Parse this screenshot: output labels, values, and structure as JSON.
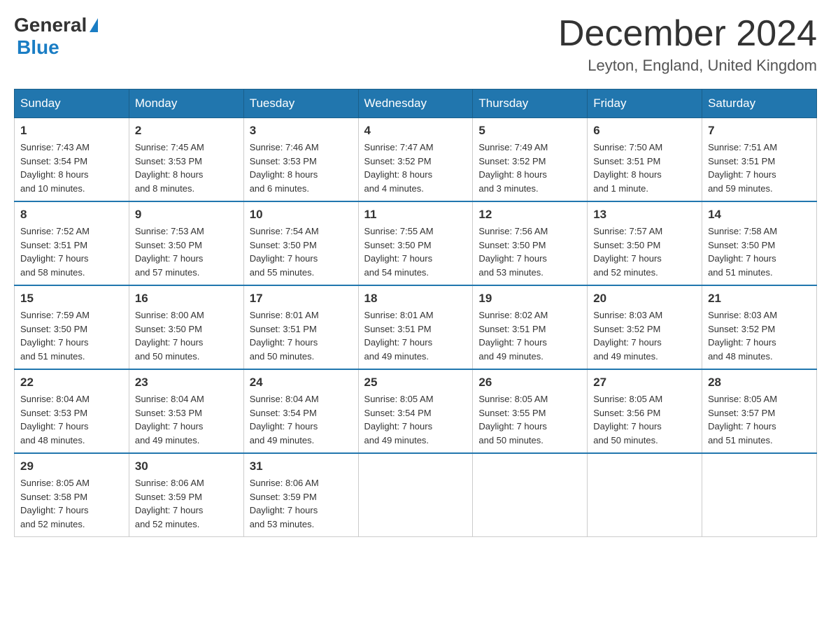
{
  "header": {
    "logo_general": "General",
    "logo_blue": "Blue",
    "title": "December 2024",
    "location": "Leyton, England, United Kingdom"
  },
  "days_of_week": [
    "Sunday",
    "Monday",
    "Tuesday",
    "Wednesday",
    "Thursday",
    "Friday",
    "Saturday"
  ],
  "weeks": [
    [
      {
        "day": "1",
        "sunrise": "7:43 AM",
        "sunset": "3:54 PM",
        "daylight": "8 hours and 10 minutes."
      },
      {
        "day": "2",
        "sunrise": "7:45 AM",
        "sunset": "3:53 PM",
        "daylight": "8 hours and 8 minutes."
      },
      {
        "day": "3",
        "sunrise": "7:46 AM",
        "sunset": "3:53 PM",
        "daylight": "8 hours and 6 minutes."
      },
      {
        "day": "4",
        "sunrise": "7:47 AM",
        "sunset": "3:52 PM",
        "daylight": "8 hours and 4 minutes."
      },
      {
        "day": "5",
        "sunrise": "7:49 AM",
        "sunset": "3:52 PM",
        "daylight": "8 hours and 3 minutes."
      },
      {
        "day": "6",
        "sunrise": "7:50 AM",
        "sunset": "3:51 PM",
        "daylight": "8 hours and 1 minute."
      },
      {
        "day": "7",
        "sunrise": "7:51 AM",
        "sunset": "3:51 PM",
        "daylight": "7 hours and 59 minutes."
      }
    ],
    [
      {
        "day": "8",
        "sunrise": "7:52 AM",
        "sunset": "3:51 PM",
        "daylight": "7 hours and 58 minutes."
      },
      {
        "day": "9",
        "sunrise": "7:53 AM",
        "sunset": "3:50 PM",
        "daylight": "7 hours and 57 minutes."
      },
      {
        "day": "10",
        "sunrise": "7:54 AM",
        "sunset": "3:50 PM",
        "daylight": "7 hours and 55 minutes."
      },
      {
        "day": "11",
        "sunrise": "7:55 AM",
        "sunset": "3:50 PM",
        "daylight": "7 hours and 54 minutes."
      },
      {
        "day": "12",
        "sunrise": "7:56 AM",
        "sunset": "3:50 PM",
        "daylight": "7 hours and 53 minutes."
      },
      {
        "day": "13",
        "sunrise": "7:57 AM",
        "sunset": "3:50 PM",
        "daylight": "7 hours and 52 minutes."
      },
      {
        "day": "14",
        "sunrise": "7:58 AM",
        "sunset": "3:50 PM",
        "daylight": "7 hours and 51 minutes."
      }
    ],
    [
      {
        "day": "15",
        "sunrise": "7:59 AM",
        "sunset": "3:50 PM",
        "daylight": "7 hours and 51 minutes."
      },
      {
        "day": "16",
        "sunrise": "8:00 AM",
        "sunset": "3:50 PM",
        "daylight": "7 hours and 50 minutes."
      },
      {
        "day": "17",
        "sunrise": "8:01 AM",
        "sunset": "3:51 PM",
        "daylight": "7 hours and 50 minutes."
      },
      {
        "day": "18",
        "sunrise": "8:01 AM",
        "sunset": "3:51 PM",
        "daylight": "7 hours and 49 minutes."
      },
      {
        "day": "19",
        "sunrise": "8:02 AM",
        "sunset": "3:51 PM",
        "daylight": "7 hours and 49 minutes."
      },
      {
        "day": "20",
        "sunrise": "8:03 AM",
        "sunset": "3:52 PM",
        "daylight": "7 hours and 49 minutes."
      },
      {
        "day": "21",
        "sunrise": "8:03 AM",
        "sunset": "3:52 PM",
        "daylight": "7 hours and 48 minutes."
      }
    ],
    [
      {
        "day": "22",
        "sunrise": "8:04 AM",
        "sunset": "3:53 PM",
        "daylight": "7 hours and 48 minutes."
      },
      {
        "day": "23",
        "sunrise": "8:04 AM",
        "sunset": "3:53 PM",
        "daylight": "7 hours and 49 minutes."
      },
      {
        "day": "24",
        "sunrise": "8:04 AM",
        "sunset": "3:54 PM",
        "daylight": "7 hours and 49 minutes."
      },
      {
        "day": "25",
        "sunrise": "8:05 AM",
        "sunset": "3:54 PM",
        "daylight": "7 hours and 49 minutes."
      },
      {
        "day": "26",
        "sunrise": "8:05 AM",
        "sunset": "3:55 PM",
        "daylight": "7 hours and 50 minutes."
      },
      {
        "day": "27",
        "sunrise": "8:05 AM",
        "sunset": "3:56 PM",
        "daylight": "7 hours and 50 minutes."
      },
      {
        "day": "28",
        "sunrise": "8:05 AM",
        "sunset": "3:57 PM",
        "daylight": "7 hours and 51 minutes."
      }
    ],
    [
      {
        "day": "29",
        "sunrise": "8:05 AM",
        "sunset": "3:58 PM",
        "daylight": "7 hours and 52 minutes."
      },
      {
        "day": "30",
        "sunrise": "8:06 AM",
        "sunset": "3:59 PM",
        "daylight": "7 hours and 52 minutes."
      },
      {
        "day": "31",
        "sunrise": "8:06 AM",
        "sunset": "3:59 PM",
        "daylight": "7 hours and 53 minutes."
      },
      null,
      null,
      null,
      null
    ]
  ],
  "labels": {
    "sunrise_prefix": "Sunrise: ",
    "sunset_prefix": "Sunset: ",
    "daylight_prefix": "Daylight: "
  }
}
